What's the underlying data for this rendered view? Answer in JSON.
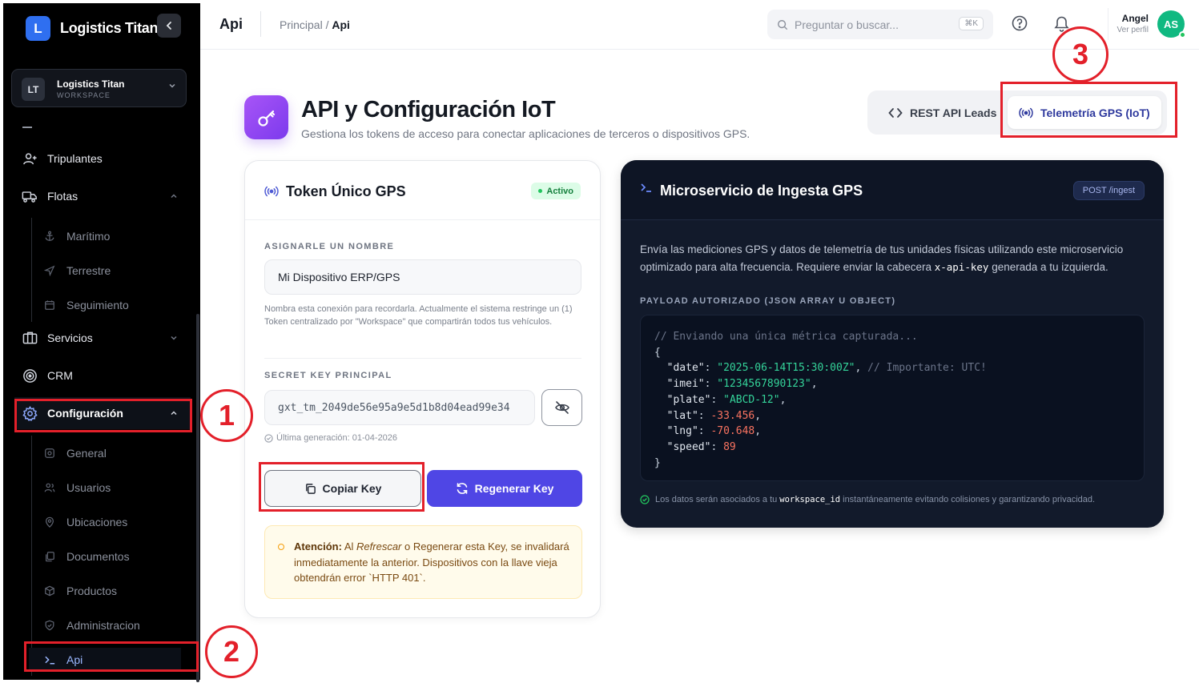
{
  "brand": {
    "logo_letter": "L",
    "name": "Logistics Titan",
    "collapse_icon": "chevron-left-icon"
  },
  "workspace": {
    "initials": "LT",
    "name": "Logistics Titan",
    "subtitle": "WORKSPACE"
  },
  "sidebar": {
    "items": [
      {
        "label": "Tripulantes",
        "icon": "user-plus-icon"
      },
      {
        "label": "Flotas",
        "icon": "truck-icon",
        "expanded": true,
        "children": [
          {
            "label": "Marítimo",
            "icon": "anchor-icon"
          },
          {
            "label": "Terrestre",
            "icon": "navigation-icon"
          },
          {
            "label": "Seguimiento",
            "icon": "calendar-icon"
          }
        ]
      },
      {
        "label": "Servicios",
        "icon": "briefcase-icon",
        "expanded": false
      },
      {
        "label": "CRM",
        "icon": "target-icon"
      },
      {
        "label": "Configuración",
        "icon": "gear-icon",
        "expanded": true,
        "active": true,
        "children": [
          {
            "label": "General",
            "icon": "settings-icon"
          },
          {
            "label": "Usuarios",
            "icon": "users-icon"
          },
          {
            "label": "Ubicaciones",
            "icon": "map-pin-icon"
          },
          {
            "label": "Documentos",
            "icon": "copy-icon"
          },
          {
            "label": "Productos",
            "icon": "box-icon"
          },
          {
            "label": "Administracion",
            "icon": "shield-icon"
          },
          {
            "label": "Api",
            "icon": "terminal-icon",
            "active": true
          }
        ]
      }
    ]
  },
  "topbar": {
    "page_name": "Api",
    "breadcrumb": [
      "Principal",
      "Api"
    ],
    "search": {
      "placeholder": "Preguntar o buscar...",
      "shortcut": "⌘K"
    },
    "user": {
      "name": "Angel",
      "subtitle": "Ver perfil",
      "initials": "AS"
    }
  },
  "header": {
    "title": "API y Configuración IoT",
    "subtitle": "Gestiona los tokens de acceso para conectar aplicaciones de terceros o dispositivos GPS.",
    "tabs": [
      {
        "label": "REST API Leads",
        "icon": "code-icon",
        "active": false
      },
      {
        "label": "Telemetría GPS (IoT)",
        "icon": "broadcast-icon",
        "active": true
      }
    ]
  },
  "token_card": {
    "title": "Token Único GPS",
    "status": "Activo",
    "name_label": "ASIGNARLE UN NOMBRE",
    "name_value": "Mi Dispositivo ERP/GPS",
    "name_help": "Nombra esta conexión para recordarla. Actualmente el sistema restringe un (1) Token centralizado por \"Workspace\" que compartirán todos tus vehículos.",
    "key_label": "SECRET KEY PRINCIPAL",
    "key_value": "gxt_tm_2049de56e95a9e5d1b8d04ead99e34",
    "generated": "Última generación: 01-04-2026",
    "copy_label": "Copiar Key",
    "regen_label": "Regenerar Key",
    "warning_title": "Atención:",
    "warning_pre": " Al ",
    "warning_em": "Refrescar",
    "warning_post": " o Regenerar esta Key, se invalidará inmediatamente la anterior. Dispositivos con la llave vieja obtendrán error `HTTP 401`."
  },
  "gps_card": {
    "title": "Microservicio de Ingesta GPS",
    "endpoint": "POST /ingest",
    "desc_pre": "Envía las mediciones GPS y datos de telemetría de tus unidades físicas utilizando este microservicio optimizado para alta frecuencia. Requiere enviar la cabecera ",
    "desc_code": "x-api-key",
    "desc_post": " generada a tu izquierda.",
    "payload_label": "PAYLOAD AUTORIZADO (JSON ARRAY U OBJECT)",
    "code_comment": "// Enviando una única métrica capturada...",
    "payload": {
      "date": "2025-06-14T15:30:00Z",
      "date_comment": "// Importante: UTC!",
      "imei": "1234567890123",
      "plate": "ABCD-12",
      "lat": "-33.456",
      "lng": "-70.648",
      "speed": "89"
    },
    "footer_pre": "Los datos serán asociados a tu",
    "footer_code": "workspace_id",
    "footer_post": "instantáneamente evitando colisiones y garantizando privacidad."
  },
  "annotations": [
    "1",
    "2",
    "3"
  ],
  "colors": {
    "accent": "#4f46e5",
    "annotation": "#e3202a",
    "success": "#22c55e",
    "sidebar_bg": "#000000",
    "dark_card": "#121a2b"
  }
}
